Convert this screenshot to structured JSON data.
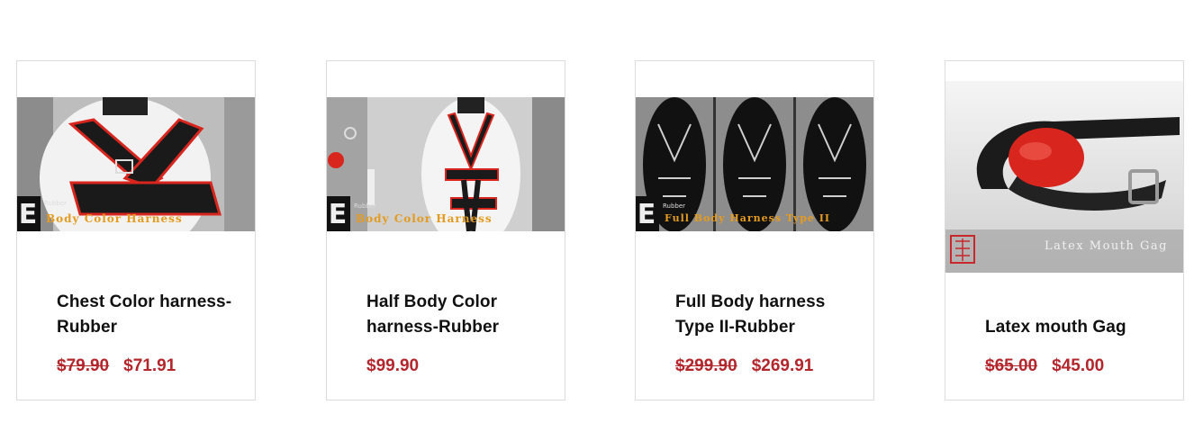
{
  "products": [
    {
      "name": "Chest Color harness-Rubber",
      "original_price": "$79.90",
      "sale_price": "$71.91",
      "image_caption": "Body Color Harness",
      "image_brand": "Rubber"
    },
    {
      "name": "Half Body Color harness-Rubber",
      "original_price": "",
      "sale_price": "$99.90",
      "image_caption": "Body Color Harness",
      "image_brand": "Rubber"
    },
    {
      "name": "Full Body harness Type II-Rubber",
      "original_price": "$299.90",
      "sale_price": "$269.91",
      "image_caption": "Full Body Harness Type II",
      "image_brand": "Rubber"
    },
    {
      "name": "Latex mouth Gag",
      "original_price": "$65.00",
      "sale_price": "$45.00",
      "image_caption": "Latex Mouth Gag"
    }
  ],
  "colors": {
    "price": "#b3262b",
    "border": "#dcdcdc",
    "harness_red": "#d8261f"
  }
}
